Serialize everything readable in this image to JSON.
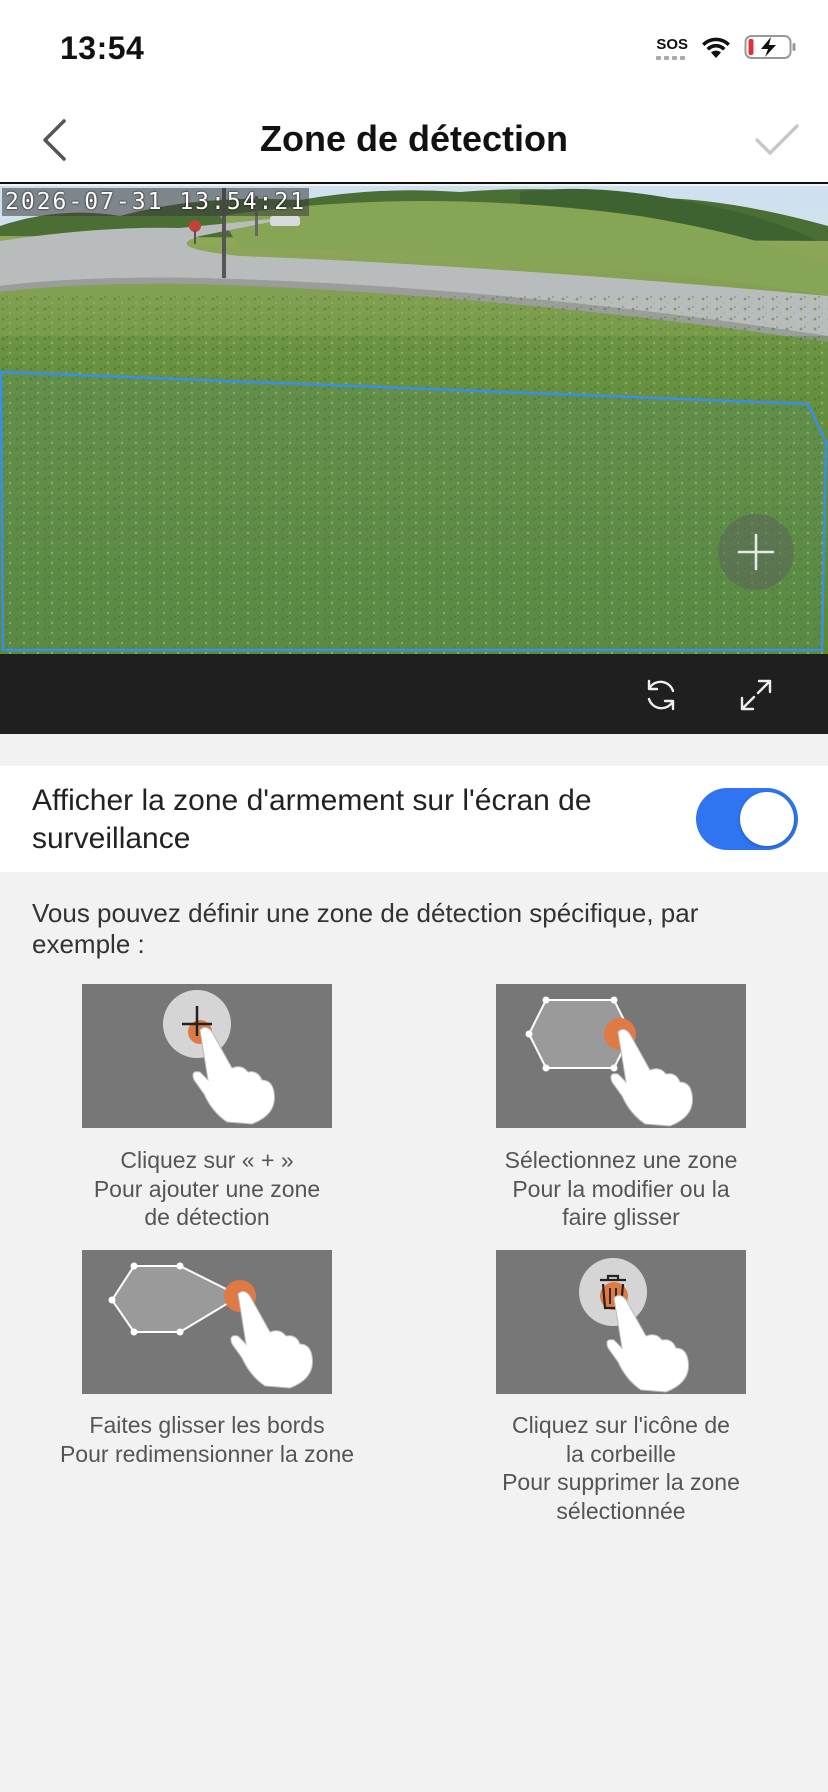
{
  "status_bar": {
    "time": "13:54",
    "sos": "SOS"
  },
  "nav": {
    "title": "Zone de détection"
  },
  "video": {
    "timestamp": "2026-07-31 13:54:21"
  },
  "toggle": {
    "label": "Afficher la zone d'armement sur l'écran de surveillance",
    "enabled": true
  },
  "hint": {
    "text": "Vous pouvez définir une zone de détection spécifique, par exemple :"
  },
  "tutorials": [
    {
      "line1": "Cliquez sur « + »",
      "line2": "Pour ajouter une zone",
      "line3": "de détection",
      "line4": ""
    },
    {
      "line1": "Sélectionnez une zone",
      "line2": "Pour la modifier ou la",
      "line3": "faire glisser",
      "line4": ""
    },
    {
      "line1": "Faites glisser les bords",
      "line2": "Pour redimensionner la zone",
      "line3": "",
      "line4": ""
    },
    {
      "line1": "Cliquez sur l'icône de",
      "line2": "la corbeille",
      "line3": "Pour supprimer la zone",
      "line4": "sélectionnée"
    }
  ],
  "colors": {
    "accent": "#2f74f0",
    "zone_outline": "#3a8ee6",
    "orange": "#e07a45",
    "toolbar": "#1f1f1f"
  }
}
